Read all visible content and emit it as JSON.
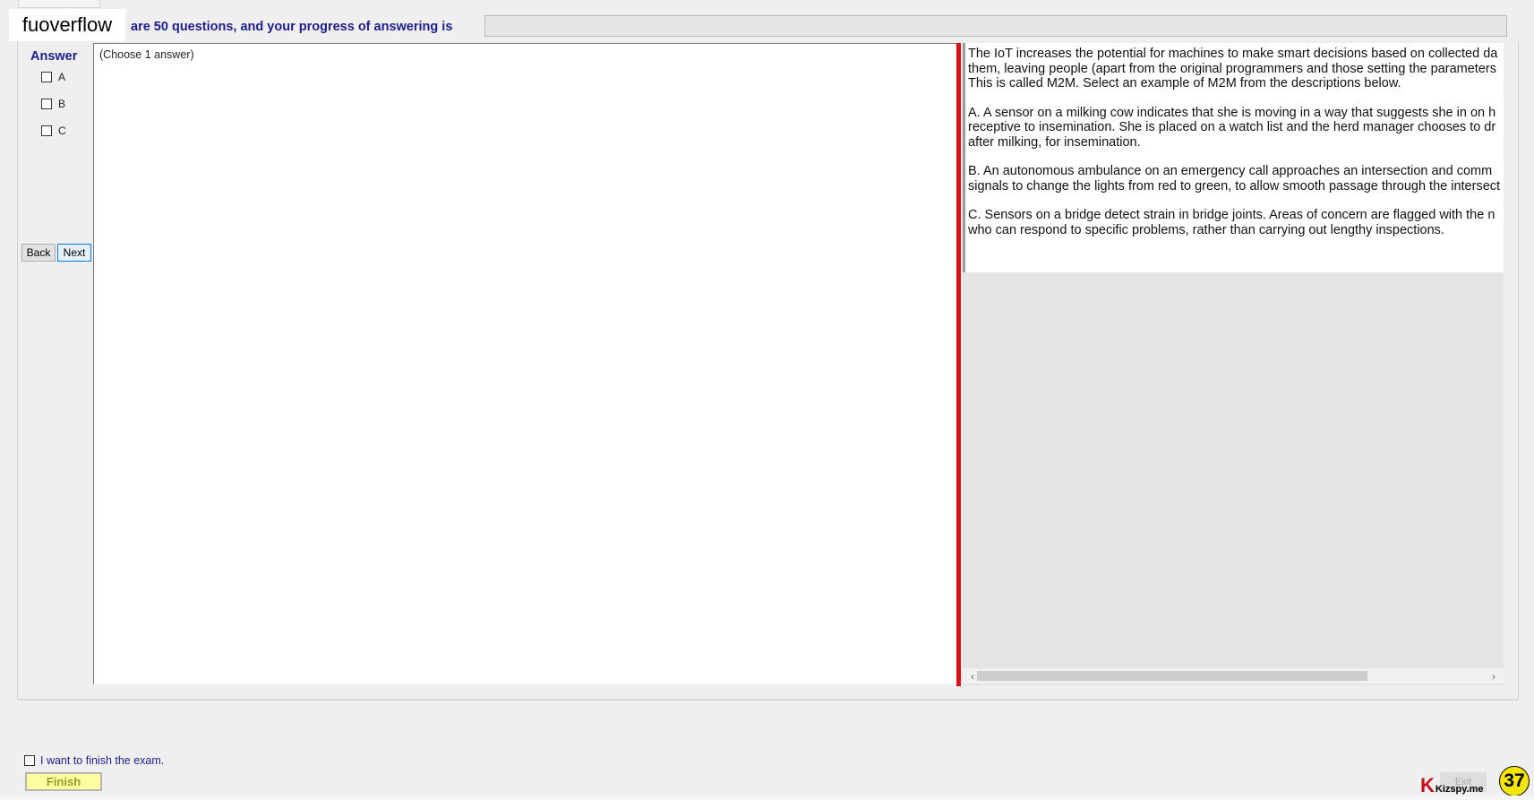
{
  "header": {
    "logo_text": "fuoverflow",
    "progress_label": "are 50 questions, and your progress of answering is",
    "progress_value": 0
  },
  "answer_panel": {
    "title": "Answer",
    "options": [
      {
        "label": "A",
        "checked": false
      },
      {
        "label": "B",
        "checked": false
      },
      {
        "label": "C",
        "checked": false
      }
    ],
    "back_label": "Back",
    "next_label": "Next"
  },
  "center": {
    "instruction": "(Choose 1 answer)"
  },
  "question": {
    "lines": [
      "The IoT increases the potential for machines to make smart decisions based on collected da",
      "them, leaving people (apart from the original programmers and those setting the parameters",
      "This is called M2M. Select an example of M2M from the descriptions below.",
      "",
      "A.  A sensor on a milking cow indicates that she is moving in a way that suggests she in on h",
      "receptive to insemination. She is placed on a watch list and the herd manager chooses to dr",
      "after milking, for insemination.",
      "",
      "B.  An autonomous ambulance on an emergency call approaches an intersection and comm",
      "signals to change the lights from red to green, to allow smooth passage through the intersect",
      "",
      "C.  Sensors on a bridge detect strain in bridge joints. Areas of concern are flagged with the n",
      "who can respond to specific problems, rather than carrying out lengthy inspections."
    ]
  },
  "footer": {
    "finish_checkbox_label": "I want to finish the exam.",
    "finish_button": "Finish",
    "exit_button": "Exit",
    "watermark_k": "K",
    "watermark_text": "Kizspy.me",
    "badge_number": "37"
  },
  "colors": {
    "label_blue": "#1e1e8a",
    "splitter_red": "#d9101a",
    "finish_yellow": "#fefe9e",
    "badge_yellow": "#f3e50a"
  }
}
